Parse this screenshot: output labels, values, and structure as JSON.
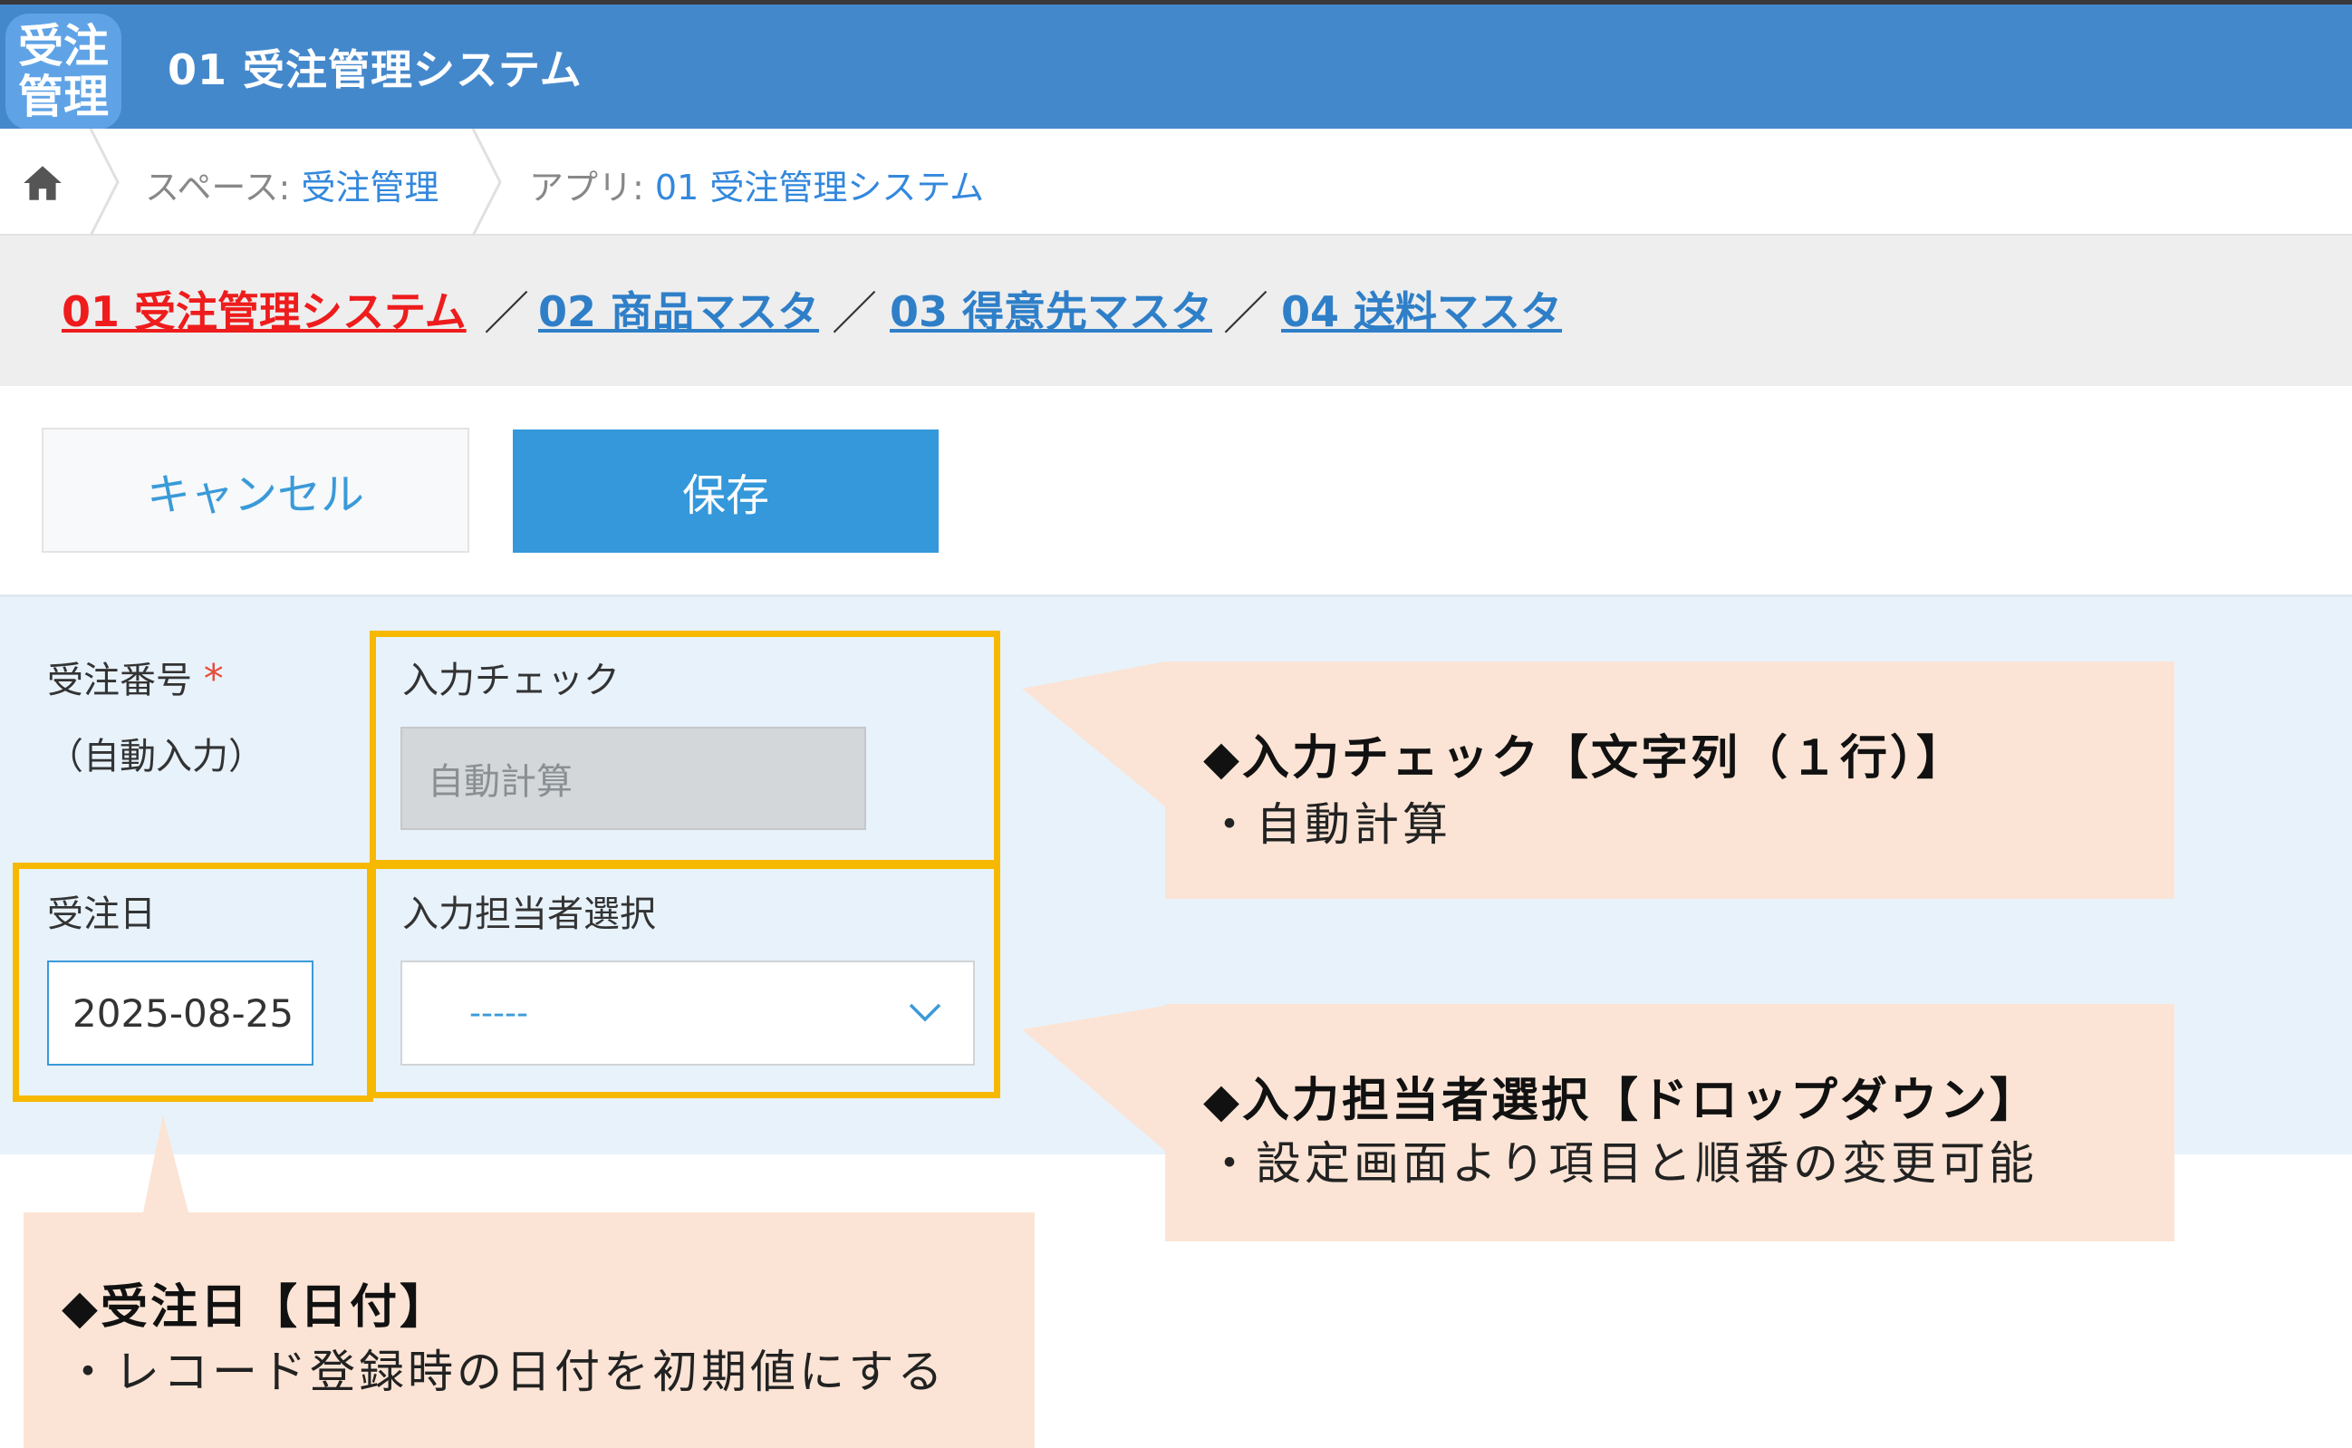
{
  "header": {
    "icon_line1": "受注",
    "icon_line2": "管理",
    "title": "01 受注管理システム"
  },
  "breadcrumb": {
    "space_prefix": "スペース: ",
    "space_name": "受注管理",
    "app_prefix": "アプリ: ",
    "app_name": "01 受注管理システム"
  },
  "related_nav": {
    "links": [
      {
        "label": "01 受注管理システム",
        "color": "#ee1c1c"
      },
      {
        "label": "02 商品マスタ",
        "color": "#2f7fc8"
      },
      {
        "label": "03 得意先マスタ",
        "color": "#2f7fc8"
      },
      {
        "label": "04 送料マスタ",
        "color": "#2f7fc8"
      }
    ],
    "separator": "／"
  },
  "toolbar": {
    "cancel_label": "キャンセル",
    "save_label": "保存"
  },
  "form": {
    "order_no_label": "受注番号",
    "required_mark": "*",
    "order_no_note": "（自動入力）",
    "input_check_label": "入力チェック",
    "input_check_value": "自動計算",
    "order_date_label": "受注日",
    "order_date_value": "2025-08-25",
    "staff_label": "入力担当者選択",
    "staff_selected": "-----"
  },
  "callouts": {
    "input_check": {
      "title": "◆入力チェック【文字列（１行）】",
      "body": "・自動計算"
    },
    "staff_select": {
      "title": "◆入力担当者選択【ドロップダウン】",
      "body": "・設定画面より項目と順番の変更可能"
    },
    "order_date": {
      "title": "◆受注日【日付】",
      "body": "・レコード登録時の日付を初期値にする"
    }
  },
  "colors": {
    "header_bg": "#4488cc",
    "highlight_border": "#f7b800",
    "callout_bg": "#fbe4d5",
    "save_button_bg": "#3498db"
  }
}
